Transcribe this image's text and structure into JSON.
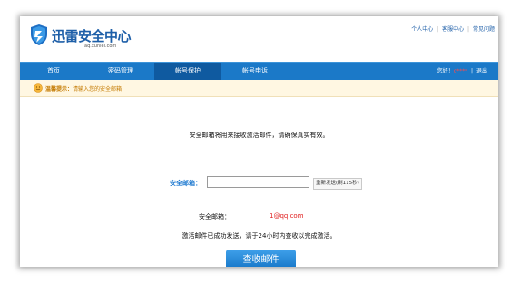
{
  "header": {
    "logo_title": "迅雷安全中心",
    "logo_subtitle": "aq.xunlei.com",
    "top_links": [
      "个人中心",
      "客服中心",
      "常见问题"
    ],
    "separator": "|"
  },
  "nav": {
    "items": [
      {
        "label": "首页",
        "active": false
      },
      {
        "label": "密码管理",
        "active": false
      },
      {
        "label": "帐号保护",
        "active": true
      },
      {
        "label": "帐号申诉",
        "active": false
      }
    ],
    "greeting": "您好！",
    "username": "c****",
    "logout": "退出"
  },
  "tip": {
    "label": "温馨提示：",
    "text": "请输入您的安全邮箱"
  },
  "form": {
    "instruction": "安全邮箱将用来接收激活邮件，请确保真实有效。",
    "email_label": "安全邮箱：",
    "email_value": "",
    "resend_label": "重新发送(剩115秒)"
  },
  "info": {
    "label": "安全邮箱：",
    "value": "1@qq.com"
  },
  "success_message": "激活邮件已成功发送，请于24小时内查收以完成激活。",
  "check_button_label": "查收邮件",
  "colors": {
    "nav_bg": "#1b79c8",
    "nav_active": "#0f5aa0",
    "accent_blue": "#1f7ad0",
    "email_red": "#e02020",
    "tip_text": "#c47a00"
  }
}
